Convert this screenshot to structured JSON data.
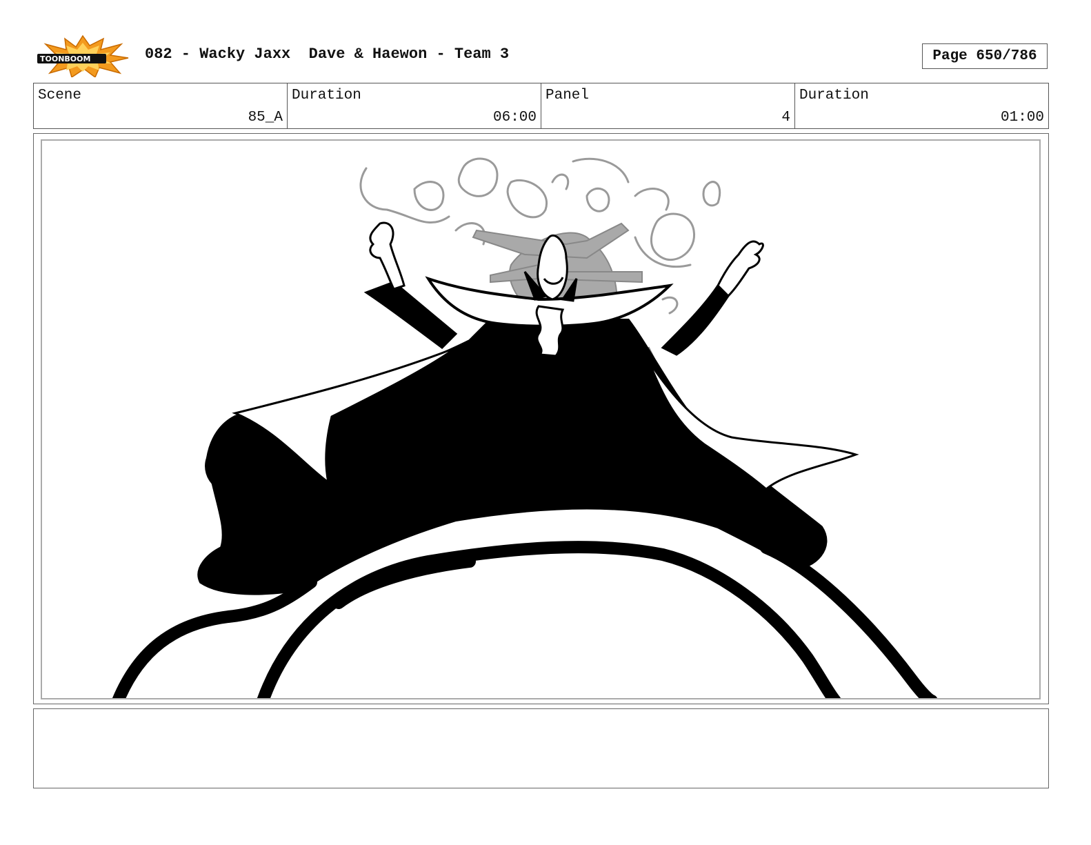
{
  "header": {
    "logo_text": "TOONBOOM",
    "title": "082 - Wacky Jaxx  Dave & Haewon - Team 3",
    "page": "Page 650/786"
  },
  "info": {
    "scene_label": "Scene",
    "scene_value": "85_A",
    "duration_label": "Duration",
    "duration_value": "06:00",
    "panel_label": "Panel",
    "panel_value": "4",
    "panel_duration_label": "Duration",
    "panel_duration_value": "01:00"
  },
  "notes": {
    "text": ""
  },
  "colors": {
    "logo_burst": "#f39a1e",
    "ink": "#000000",
    "sketch_gray": "#9a9a9a"
  }
}
